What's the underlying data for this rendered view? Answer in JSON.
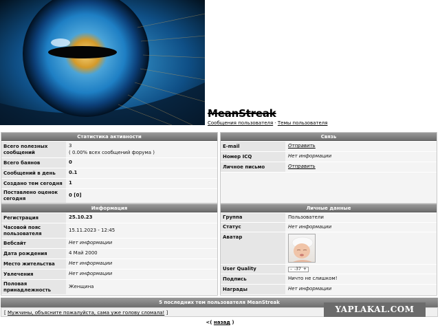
{
  "profile": {
    "username": "MeanStreak",
    "link_posts": "Сообщения пользователя",
    "link_separator": "·",
    "link_topics": "Темы пользователя"
  },
  "stats": {
    "title": "Статистика активности",
    "rows": [
      {
        "label": "Всего полезных сообщений",
        "value": "3",
        "sub": "( 0.00% всех сообщений форума )"
      },
      {
        "label": "Всего баянов",
        "value": "0"
      },
      {
        "label": "Сообщений в день",
        "value": "0.1"
      },
      {
        "label": "Создано тем сегодня",
        "value": "1"
      },
      {
        "label": "Поставлено оценок сегодня",
        "value": "0 [0]"
      }
    ]
  },
  "contact": {
    "title": "Связь",
    "rows": [
      {
        "label": "E-mail",
        "value": "Отправить"
      },
      {
        "label": "Номер ICQ",
        "value": "Нет информации"
      },
      {
        "label": "Личное письмо",
        "value": "Отправить"
      }
    ]
  },
  "info": {
    "title": "Информация",
    "rows": [
      {
        "label": "Регистрация",
        "value": "25.10.23"
      },
      {
        "label": "Часовой пояс пользователя",
        "value": "15.11.2023 - 12:45"
      },
      {
        "label": "Вебсайт",
        "value": "Нет информации"
      },
      {
        "label": "Дата рождения",
        "value": "4 Май 2000"
      },
      {
        "label": "Место жительства",
        "value": "Нет информации"
      },
      {
        "label": "Увлечения",
        "value": "Нет информации"
      },
      {
        "label": "Половая принадлежность",
        "value": "Женщина"
      }
    ]
  },
  "personal": {
    "title": "Личные данные",
    "group_label": "Группа",
    "group_value": "Пользователи",
    "status_label": "Статус",
    "status_value": "Нет информации",
    "avatar_label": "Аватар",
    "quality_label": "User Quality",
    "quality_minus": "–",
    "quality_value": "-37",
    "quality_plus": "+",
    "signature_label": "Подпись",
    "signature_value": "Ничто не слишком!",
    "awards_label": "Награды",
    "awards_value": "Нет информации"
  },
  "topics": {
    "title": "5 последних тем пользователя MeanStreak",
    "bracket_open": "[",
    "item": "Мужчины, объясните пожалуйста, сама уже голову сломала!",
    "bracket_close": "]"
  },
  "nav": {
    "back_prefix": "<(",
    "back_label": "назад",
    "back_suffix": ")"
  },
  "watermark": "YAPLAKAL.COM",
  "colors": {
    "header_bar": "#7f7f7f",
    "label_bg": "#e6e6e6",
    "value_bg": "#f4f4f4",
    "eye_blue": "#1e90d6",
    "eye_gold": "#d49a2a"
  }
}
